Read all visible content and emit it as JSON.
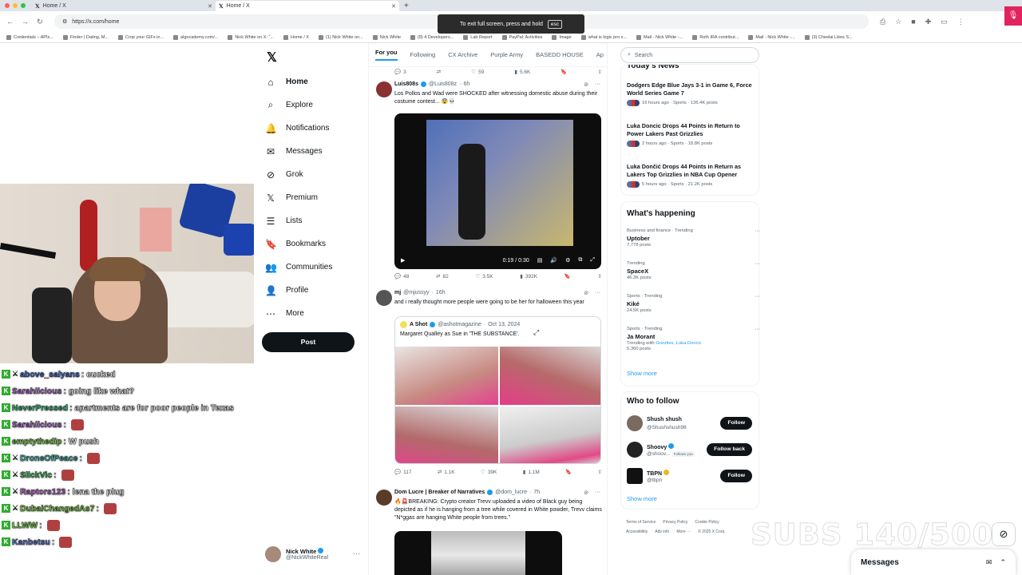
{
  "browser": {
    "tabs": [
      {
        "title": "Home / X",
        "active": false
      },
      {
        "title": "Home / X",
        "active": true
      }
    ],
    "url": "https://x.com/home",
    "fullscreen_toast": "To exit full screen, press and hold",
    "fullscreen_key": "esc",
    "bookmarks": [
      "Credentials – APIs...",
      "Finder | Dating, M...",
      "Crop your GIFs in...",
      "algocademy.com/...",
      "Nick White on X: \"...",
      "Home / X",
      "(1) Nick White on...",
      "Nick White",
      "(8) 4 Developers...",
      "Lab Report",
      "PayPal: Activities",
      "Image",
      "what is logic pro x...",
      "Mail - Nick White -...",
      "Roth IRA contribut...",
      "Mail - Nick White -...",
      "(3) Cheelai Likes S..."
    ]
  },
  "sidebar": {
    "items": [
      {
        "label": "Home",
        "icon": "home-icon"
      },
      {
        "label": "Explore",
        "icon": "search-icon"
      },
      {
        "label": "Notifications",
        "icon": "bell-icon"
      },
      {
        "label": "Messages",
        "icon": "envelope-icon"
      },
      {
        "label": "Grok",
        "icon": "grok-icon"
      },
      {
        "label": "Premium",
        "icon": "x-premium-icon"
      },
      {
        "label": "Lists",
        "icon": "list-icon"
      },
      {
        "label": "Bookmarks",
        "icon": "bookmark-icon"
      },
      {
        "label": "Communities",
        "icon": "communities-icon"
      },
      {
        "label": "Profile",
        "icon": "person-icon"
      },
      {
        "label": "More",
        "icon": "more-circle-icon"
      }
    ],
    "post_label": "Post",
    "profile": {
      "name": "Nick White",
      "handle": "@NickWhiteReal"
    }
  },
  "chat": [
    {
      "user": "above_salyans",
      "text": ": cucked",
      "color": "#3f6bdc",
      "mod": true
    },
    {
      "user": "Sarahlicious",
      "text": ": going like what?",
      "color": "#b46bd6",
      "mod": false
    },
    {
      "user": "NeverPressed",
      "text": ": apartments are for poor people in Texas",
      "color": "#3bc47c",
      "mod": false
    },
    {
      "user": "Sarahlicious",
      "text": ":",
      "color": "#b46bd6",
      "mod": false,
      "emote": true
    },
    {
      "user": "emptythedip",
      "text": ": W push",
      "color": "#7ad33f",
      "mod": false
    },
    {
      "user": "DroneOfPeace",
      "text": ":",
      "color": "#3fb8b0",
      "mod": true,
      "emote": true
    },
    {
      "user": "SlickVic",
      "text": ":",
      "color": "#3fbf5b",
      "mod": true,
      "emote": true
    },
    {
      "user": "Raptors123",
      "text": ": lena the plug",
      "color": "#c66bd6",
      "mod": true
    },
    {
      "user": "DubaiChangedAs7",
      "text": ":",
      "color": "#7ad33f",
      "mod": true,
      "emote": true
    },
    {
      "user": "LLWW",
      "text": ":",
      "color": "#7ad33f",
      "mod": false,
      "emote": true
    },
    {
      "user": "Kanbetsu",
      "text": ":",
      "color": "#5a7bd8",
      "mod": false,
      "emote": true
    }
  ],
  "feed": {
    "tabs": [
      "For you",
      "Following",
      "CX Archive",
      "Purple Army",
      "BASEDD HOUSE",
      "Ap"
    ],
    "top_actions": {
      "replies": "3",
      "reposts": "",
      "likes": "59",
      "views": "5.6K"
    },
    "tweets": [
      {
        "name": "Luis808s",
        "handle": "@Luis808z",
        "time": "6h",
        "text": "Los Pollos and Wad were SHOCKED after witnessing domestic abuse during their costume contest... 😨💀",
        "video_time": "0:19 / 0:30",
        "replies": "48",
        "reposts": "82",
        "likes": "3.5K",
        "views": "392K"
      },
      {
        "name": "mj",
        "handle": "@mjussyy",
        "time": "16h",
        "text": "and i really thought more people were going to be her for halloween this year",
        "quote": {
          "name": "A Shot",
          "handle": "@ashotmagazine",
          "time": "Oct 13, 2024",
          "text": "Margaret Qualley as Sue in 'THE SUBSTANCE'."
        },
        "replies": "117",
        "reposts": "1.1K",
        "likes": "39K",
        "views": "1.1M"
      },
      {
        "name": "Dom Lucre | Breaker of Narratives",
        "handle": "@dom_lucre",
        "time": "7h",
        "text": "🔥🚨BREAKING: Crypto creator Trevv uploaded a video of Black guy being depicted as if he is hanging from a tree while covered in White powder, Trevv claims \"N*ggas are hanging White people from trees.\""
      }
    ]
  },
  "right": {
    "search_placeholder": "Search",
    "news_title": "Today's News",
    "news": [
      {
        "headline": "Dodgers Edge Blue Jays 3-1 in Game 6, Force World Series Game 7",
        "meta": "16 hours ago · Sports · 136.4K posts"
      },
      {
        "headline": "Luka Doncic Drops 44 Points in Return to Power Lakers Past Grizzlies",
        "meta": "2 hours ago · Sports · 18.8K posts"
      },
      {
        "headline": "Luka Dončić Drops 44 Points in Return as Lakers Top Grizzlies in NBA Cup Opener",
        "meta": "5 hours ago · Sports · 21.2K posts"
      }
    ],
    "happening_title": "What's happening",
    "trends": [
      {
        "category": "Business and finance · Trending",
        "name": "Uptober",
        "posts": "7,778 posts"
      },
      {
        "category": "Trending",
        "name": "SpaceX",
        "posts": "46.3K posts"
      },
      {
        "category": "Sports · Trending",
        "name": "Kiké",
        "posts": "24.5K posts"
      },
      {
        "category": "Sports · Trending",
        "name": "Ja Morant",
        "with_label": "Trending with",
        "with_links": "Grizzlies, Luka Doncic",
        "posts": "5,360 posts"
      }
    ],
    "show_more": "Show more",
    "wtf_title": "Who to follow",
    "follow": [
      {
        "name": "Shush shush",
        "handle": "@Shushshush98",
        "button": "Follow"
      },
      {
        "name": "Shoovy",
        "handle": "@shoov...",
        "button": "Follow back",
        "follows_you": "Follows you"
      },
      {
        "name": "TBPN",
        "handle": "@tbpn",
        "button": "Follow"
      }
    ],
    "show_more2": "Show more",
    "footer": [
      "Terms of Service",
      "Privacy Policy",
      "Cookie Policy",
      "Accessibility",
      "Ads info",
      "More ···",
      "© 2025 X Corp."
    ]
  },
  "overlay": {
    "subs": "SUBS 140/500"
  },
  "messages": {
    "title": "Messages"
  }
}
